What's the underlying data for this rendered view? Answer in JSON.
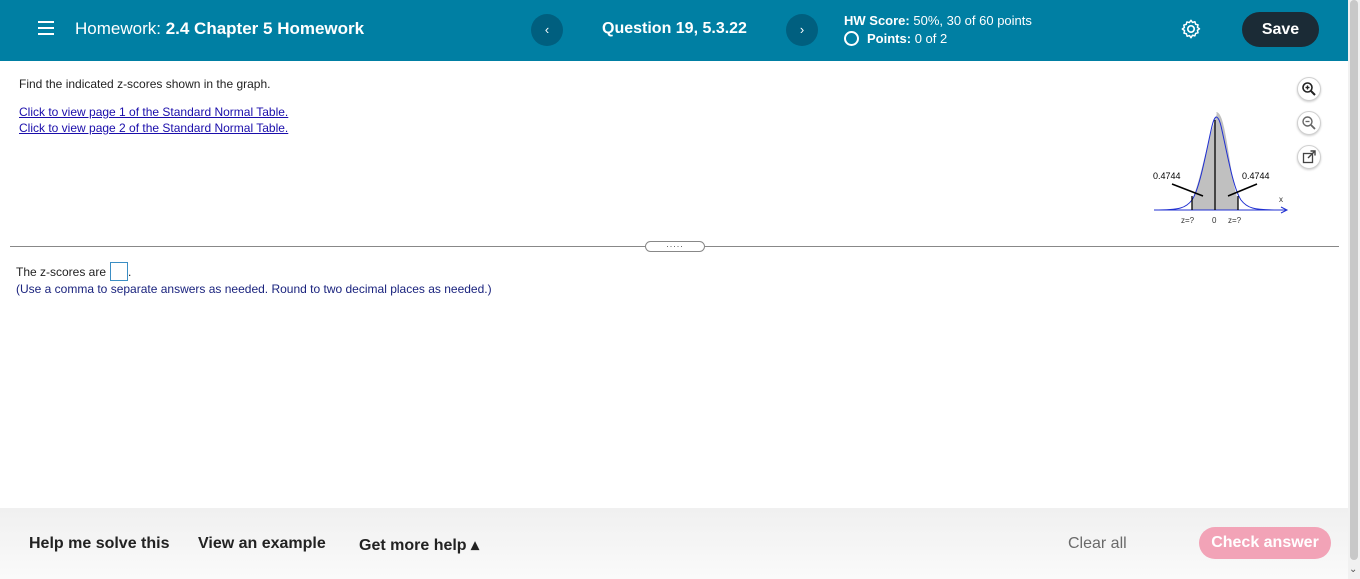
{
  "header": {
    "assignment_prefix": "Homework:",
    "assignment_name": "2.4 Chapter 5 Homework",
    "prev_label": "‹",
    "next_label": "›",
    "question_label": "Question 19, 5.3.22",
    "hw_score_label": "HW Score:",
    "hw_score_value": "50%, 30 of 60 points",
    "points_label": "Points:",
    "points_value": "0 of 2",
    "save_label": "Save"
  },
  "question": {
    "prompt": "Find the indicated z-scores shown in the graph.",
    "link1": "Click to view page 1 of the Standard Normal Table.",
    "link2": "Click to view page 2 of the Standard Normal Table."
  },
  "graph": {
    "left_area": "0.4744",
    "right_area": "0.4744",
    "left_z_label": "z=?",
    "center_label": "0",
    "right_z_label": "z=?",
    "x_axis_label": "x",
    "curve_color": "#1f2fd1",
    "shade_color": "#c0c0c0"
  },
  "answer": {
    "lead": "The z-scores are",
    "instructions": "(Use a comma to separate answers as needed. Round to two decimal places as needed.)"
  },
  "footer": {
    "help_solve": "Help me solve this",
    "view_example": "View an example",
    "more_help": "Get more help ▴",
    "clear_all": "Clear all",
    "check_answer": "Check answer"
  },
  "colors": {
    "topbar": "#007fa3",
    "save_button": "#1b2b36",
    "check_answer_disabled": "#f2a3b7"
  }
}
